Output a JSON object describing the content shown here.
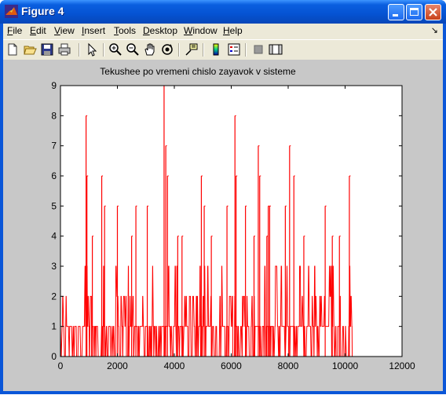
{
  "window": {
    "title": "Figure 4"
  },
  "menu": [
    {
      "pre": "",
      "ul": "F",
      "post": "ile"
    },
    {
      "pre": "",
      "ul": "E",
      "post": "dit"
    },
    {
      "pre": "",
      "ul": "V",
      "post": "iew"
    },
    {
      "pre": "",
      "ul": "I",
      "post": "nsert"
    },
    {
      "pre": "",
      "ul": "T",
      "post": "ools"
    },
    {
      "pre": "",
      "ul": "D",
      "post": "esktop"
    },
    {
      "pre": "",
      "ul": "W",
      "post": "indow"
    },
    {
      "pre": "",
      "ul": "H",
      "post": "elp"
    }
  ],
  "toolbar_icons": [
    "new-figure-icon",
    "open-file-icon",
    "save-icon",
    "print-icon",
    "edit-plot-arrow-icon",
    "zoom-in-icon",
    "zoom-out-icon",
    "pan-hand-icon",
    "rotate-3d-icon",
    "data-cursor-icon",
    "colorbar-icon",
    "legend-icon",
    "hide-plot-tools-icon",
    "show-plot-tools-icon"
  ],
  "colors": {
    "series": "#ff0000",
    "figure_bg": "#c8c8c8",
    "axes_bg": "#ffffff",
    "title_blue": "#0553d2"
  },
  "chart_data": {
    "type": "line",
    "title": "Tekushee po vremeni chislo zayavok v sisteme",
    "xlabel": "",
    "ylabel": "",
    "xlim": [
      0,
      12000
    ],
    "ylim": [
      0,
      9
    ],
    "xticks": [
      "0",
      "2000",
      "4000",
      "6000",
      "8000",
      "10000",
      "12000"
    ],
    "yticks": [
      "0",
      "1",
      "2",
      "3",
      "4",
      "5",
      "6",
      "7",
      "8",
      "9"
    ],
    "grid": false,
    "series": [
      {
        "style": "step",
        "spikes": [
          {
            "x": 900,
            "y": 8
          },
          {
            "x": 930,
            "y": 6
          },
          {
            "x": 1120,
            "y": 4
          },
          {
            "x": 1450,
            "y": 6
          },
          {
            "x": 1550,
            "y": 5
          },
          {
            "x": 2000,
            "y": 5
          },
          {
            "x": 2500,
            "y": 4
          },
          {
            "x": 2650,
            "y": 5
          },
          {
            "x": 3050,
            "y": 5
          },
          {
            "x": 3640,
            "y": 9
          },
          {
            "x": 3700,
            "y": 7
          },
          {
            "x": 3760,
            "y": 6
          },
          {
            "x": 4120,
            "y": 4
          },
          {
            "x": 4270,
            "y": 4
          },
          {
            "x": 4950,
            "y": 6
          },
          {
            "x": 5050,
            "y": 5
          },
          {
            "x": 5300,
            "y": 4
          },
          {
            "x": 5850,
            "y": 5
          },
          {
            "x": 6130,
            "y": 8
          },
          {
            "x": 6170,
            "y": 6
          },
          {
            "x": 6500,
            "y": 5
          },
          {
            "x": 6800,
            "y": 4
          },
          {
            "x": 6950,
            "y": 7
          },
          {
            "x": 7000,
            "y": 6
          },
          {
            "x": 7250,
            "y": 4
          },
          {
            "x": 7300,
            "y": 5
          },
          {
            "x": 7350,
            "y": 5
          },
          {
            "x": 7900,
            "y": 5
          },
          {
            "x": 8050,
            "y": 7
          },
          {
            "x": 8200,
            "y": 6
          },
          {
            "x": 8550,
            "y": 4
          },
          {
            "x": 9300,
            "y": 5
          },
          {
            "x": 9550,
            "y": 4
          },
          {
            "x": 9800,
            "y": 4
          },
          {
            "x": 10150,
            "y": 6
          }
        ],
        "x_end": 10250
      }
    ]
  }
}
